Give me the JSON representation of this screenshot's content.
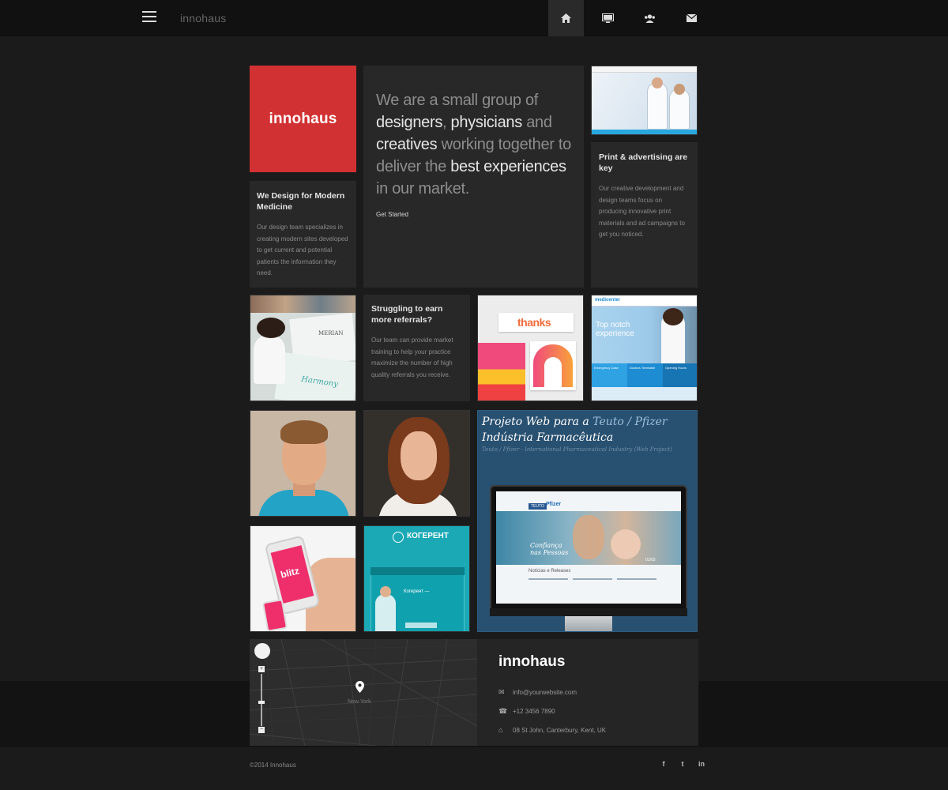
{
  "header": {
    "brand": "innohaus",
    "nav": [
      {
        "name": "home-icon",
        "glyph": "⌂"
      },
      {
        "name": "monitor-icon",
        "glyph": "▭"
      },
      {
        "name": "team-icon",
        "glyph": "👥"
      },
      {
        "name": "mail-icon",
        "glyph": "✉"
      }
    ]
  },
  "logo_tile": {
    "text": "innohaus"
  },
  "intro": {
    "p1": "We are a small group of",
    "w_designers": "designers",
    "comma": ", ",
    "w_physicians": "physicians",
    "and": " and",
    "w_creatives": "creatives",
    "working": " working together to deliver the ",
    "w_best": "best",
    "w_experiences": "experiences",
    "end": " in our market.",
    "cta": "Get Started"
  },
  "print_tile": {
    "title": "Print & advertising are key",
    "body": "Our creative development and design teams focus on producing innovative print materials and ad campaigns to get you noticed."
  },
  "design_tile": {
    "title": "We Design for Modern Medicine",
    "body": "Our design team specializes in creating modern sites developed to get current and potential patients the information they need."
  },
  "referral_tile": {
    "title": "Struggling to earn more referrals?",
    "body": "Our team can provide market training to help your practice maximize the number of high quality referrals you receive."
  },
  "thumbs": {
    "harmony": {
      "brand": "MERIAN",
      "word": "Harmony"
    },
    "thanks": {
      "word": "thanks"
    },
    "medic": {
      "nav": "medicenter",
      "headline": "Top notch experience",
      "panels": [
        "Emergency Case",
        "Doctors Timetable",
        "Opening Hours"
      ]
    },
    "blitz": {
      "word": "blitz"
    },
    "kogerent": {
      "brand": "КОГЕРЕНТ",
      "headline": "Когерент —"
    }
  },
  "project": {
    "title_a": "Projeto Web para a ",
    "title_b": "Teuto / Pfizer",
    "title_c": "Indústria Farmacêutica",
    "subtitle": "Teuto / Pfizer - International Pharmaceutical Industry (Web Project)",
    "screen": {
      "badge_a": "TEUTO",
      "badge_b": "Pfizer",
      "headline_a": "Confiança",
      "headline_b": "nas Pessoas",
      "news": "Notícias e Releases",
      "slide": "01/03"
    }
  },
  "map": {
    "city": "New York",
    "zoom_in": "+",
    "zoom_out": "−"
  },
  "contact": {
    "brand": "innohaus",
    "email": "info@yourwebsite.com",
    "phone": "+12 3456 7890",
    "address": "08 St John, Canterbury, Kent, UK"
  },
  "footer": {
    "copyright": "©2014 Innohaus",
    "social": [
      {
        "name": "facebook-icon",
        "glyph": "f"
      },
      {
        "name": "twitter-icon",
        "glyph": "t"
      },
      {
        "name": "linkedin-icon",
        "glyph": "in"
      }
    ]
  },
  "colors": {
    "accent": "#d23133",
    "background": "#1b1b1b",
    "tile": "#282828",
    "project_bg": "#285070"
  }
}
